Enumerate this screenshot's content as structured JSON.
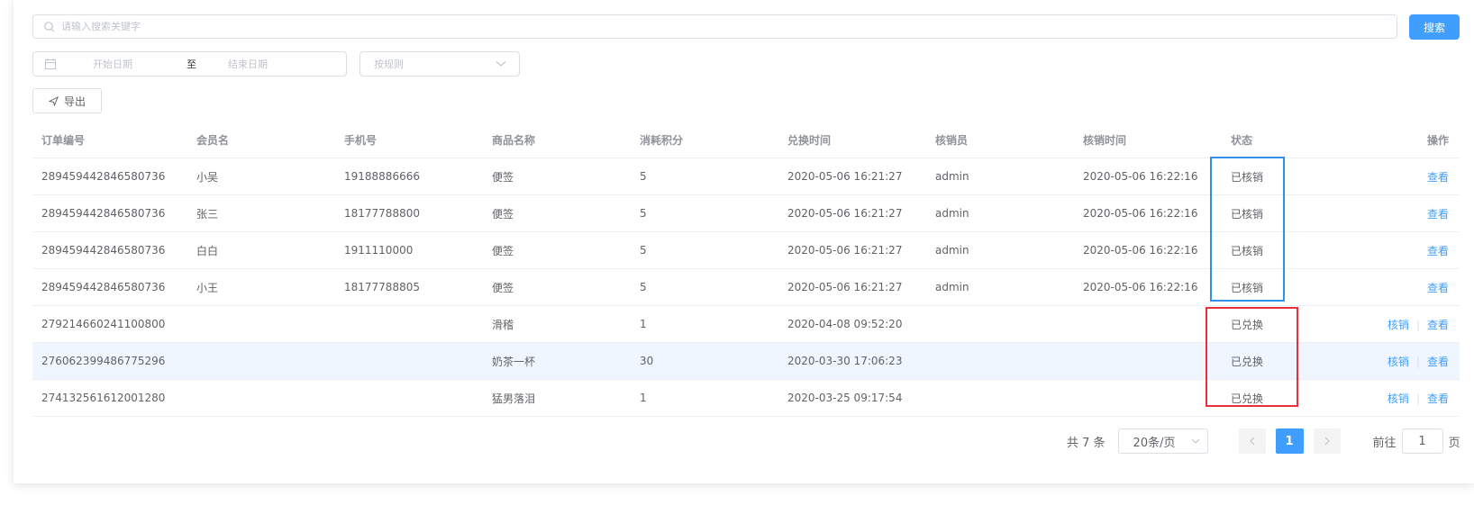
{
  "search": {
    "placeholder": "请输入搜索关键字",
    "button_label": "搜索"
  },
  "filters": {
    "start_date_placeholder": "开始日期",
    "range_separator": "至",
    "end_date_placeholder": "结束日期",
    "rule_select_placeholder": "按规则"
  },
  "toolbar": {
    "export_label": "导出"
  },
  "table": {
    "columns": [
      "订单编号",
      "会员名",
      "手机号",
      "商品名称",
      "消耗积分",
      "兑换时间",
      "核销员",
      "核销时间",
      "状态",
      "操作"
    ],
    "rows": [
      {
        "order_no": "289459442846580736",
        "member": "小吴",
        "phone": "19188886666",
        "product": "便签",
        "points": "5",
        "exchange_time": "2020-05-06 16:21:27",
        "verifier": "admin",
        "verify_time": "2020-05-06 16:22:16",
        "status": "已核销",
        "actions": [
          "查看"
        ]
      },
      {
        "order_no": "289459442846580736",
        "member": "张三",
        "phone": "18177788800",
        "product": "便签",
        "points": "5",
        "exchange_time": "2020-05-06 16:21:27",
        "verifier": "admin",
        "verify_time": "2020-05-06 16:22:16",
        "status": "已核销",
        "actions": [
          "查看"
        ]
      },
      {
        "order_no": "289459442846580736",
        "member": "白白",
        "phone": "1911110000",
        "product": "便签",
        "points": "5",
        "exchange_time": "2020-05-06 16:21:27",
        "verifier": "admin",
        "verify_time": "2020-05-06 16:22:16",
        "status": "已核销",
        "actions": [
          "查看"
        ]
      },
      {
        "order_no": "289459442846580736",
        "member": "小王",
        "phone": "18177788805",
        "product": "便签",
        "points": "5",
        "exchange_time": "2020-05-06 16:21:27",
        "verifier": "admin",
        "verify_time": "2020-05-06 16:22:16",
        "status": "已核销",
        "actions": [
          "查看"
        ]
      },
      {
        "order_no": "279214660241100800",
        "member": "",
        "phone": "",
        "product": "滑稽",
        "points": "1",
        "exchange_time": "2020-04-08 09:52:20",
        "verifier": "",
        "verify_time": "",
        "status": "已兑换",
        "actions": [
          "核销",
          "查看"
        ]
      },
      {
        "order_no": "276062399486775296",
        "member": "",
        "phone": "",
        "product": "奶茶一杯",
        "points": "30",
        "exchange_time": "2020-03-30 17:06:23",
        "verifier": "",
        "verify_time": "",
        "status": "已兑换",
        "actions": [
          "核销",
          "查看"
        ]
      },
      {
        "order_no": "274132561612001280",
        "member": "",
        "phone": "",
        "product": "猛男落泪",
        "points": "1",
        "exchange_time": "2020-03-25 09:17:54",
        "verifier": "",
        "verify_time": "",
        "status": "已兑换",
        "actions": [
          "核销",
          "查看"
        ]
      }
    ]
  },
  "pagination": {
    "total_label": "共 7 条",
    "page_size": "20条/页",
    "current_page": "1",
    "goto_prefix": "前往",
    "goto_value": "1",
    "goto_suffix": "页"
  },
  "colors": {
    "primary": "#409eff",
    "highlight_blue": "#3390e8",
    "highlight_red": "#e8303a"
  }
}
